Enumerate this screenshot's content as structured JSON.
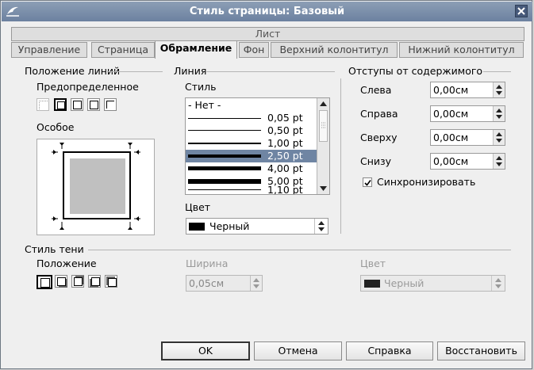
{
  "window": {
    "title": "Стиль страницы: Базовый"
  },
  "tabs": {
    "top_row": "Лист",
    "items": [
      "Управление",
      "Страница",
      "Обрамление",
      "Фон",
      "Верхний колонтитул",
      "Нижний колонтитул"
    ],
    "active": "Обрамление"
  },
  "line_position": {
    "heading": "Положение линий",
    "predefined_label": "Предопределенное",
    "special_label": "Особое"
  },
  "line": {
    "heading": "Линия",
    "style_label": "Стиль",
    "styles": [
      "- Нет -",
      "0,05 pt",
      "0,50 pt",
      "1,00 pt",
      "2,50 pt",
      "4,00 pt",
      "5,00 pt",
      "1,10 pt"
    ],
    "selected_style": "2,50 pt",
    "color_label": "Цвет",
    "color_value": "Черный"
  },
  "spacing": {
    "heading": "Отступы от содержимого",
    "left_label": "Слева",
    "left_value": "0,00см",
    "right_label": "Справа",
    "right_value": "0,00см",
    "top_label": "Сверху",
    "top_value": "0,00см",
    "bottom_label": "Снизу",
    "bottom_value": "0,00см",
    "sync_label": "Синхронизировать",
    "sync_checked": true
  },
  "shadow": {
    "heading": "Стиль тени",
    "position_label": "Положение",
    "width_label": "Ширина",
    "width_value": "0,05см",
    "color_label": "Цвет",
    "color_value": "Черный"
  },
  "buttons": {
    "ok": "OK",
    "cancel": "Отмена",
    "help": "Справка",
    "reset": "Восстановить"
  },
  "colors": {
    "titlebar": "#7a8ea9",
    "selection": "#6f85a3",
    "swatch": "#000000"
  }
}
